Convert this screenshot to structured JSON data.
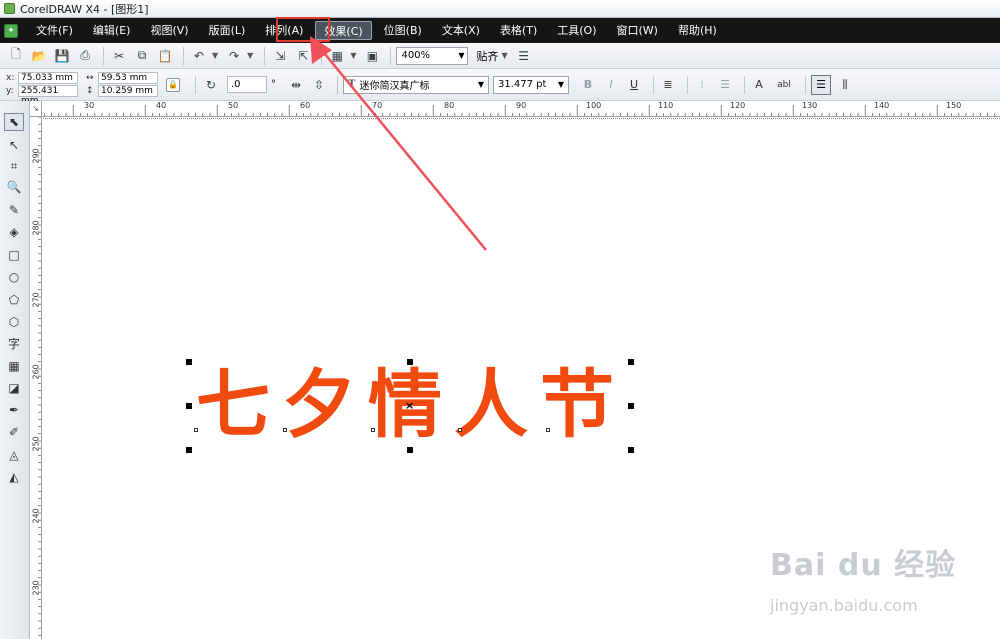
{
  "window": {
    "title": "CorelDRAW X4 - [图形1]"
  },
  "menu": {
    "items": [
      {
        "label": "文件(F)"
      },
      {
        "label": "编辑(E)"
      },
      {
        "label": "视图(V)"
      },
      {
        "label": "版面(L)"
      },
      {
        "label": "排列(A)"
      },
      {
        "label": "效果(C)",
        "active": true
      },
      {
        "label": "位图(B)"
      },
      {
        "label": "文本(X)"
      },
      {
        "label": "表格(T)"
      },
      {
        "label": "工具(O)"
      },
      {
        "label": "窗口(W)"
      },
      {
        "label": "帮助(H)"
      }
    ]
  },
  "standard_toolbar": {
    "icons": [
      "new-icon",
      "open-icon",
      "save-icon",
      "print-icon",
      "cut-icon",
      "copy-icon",
      "paste-icon",
      "undo-icon",
      "redo-icon",
      "import-icon",
      "export-icon",
      "application-launcher-icon",
      "welcome-screen-icon"
    ],
    "zoom_level": "400%",
    "snap_label": "贴齐"
  },
  "property_bar": {
    "x_label": "x:",
    "x_value": "75.033 mm",
    "y_label": "y:",
    "y_value": "255.431 mm",
    "width_value": "59.53 mm",
    "height_value": "10.259 mm",
    "rotation_value": ".0",
    "rotation_unit": "°",
    "font_name": "迷你简汉真广标",
    "font_size": "31.477 pt",
    "bold_label": "B",
    "italic_label": "I",
    "underline_label": "U",
    "text_abl_label": "abl"
  },
  "rulers": {
    "horizontal_labels": [
      "30",
      "40",
      "50",
      "60",
      "70",
      "80",
      "90",
      "100",
      "110",
      "120",
      "130",
      "140",
      "150"
    ],
    "vertical_labels": [
      "290",
      "280",
      "270",
      "260",
      "250",
      "240",
      "230"
    ],
    "corner_glyph": "↘"
  },
  "toolbox": {
    "tools": [
      "pick-tool-icon",
      "shape-tool-icon",
      "crop-tool-icon",
      "zoom-tool-icon",
      "freehand-tool-icon",
      "smart-fill-tool-icon",
      "rectangle-tool-icon",
      "ellipse-tool-icon",
      "polygon-tool-icon",
      "basic-shapes-tool-icon",
      "text-tool-icon",
      "table-tool-icon",
      "interactive-tool-icon",
      "eyedropper-tool-icon",
      "outline-tool-icon",
      "fill-tool-icon",
      "interactive-fill-icon"
    ],
    "text_tool_glyph": "字"
  },
  "canvas": {
    "artwork_text": "七夕情人节",
    "artwork_color": "#f04a0e"
  },
  "watermark": {
    "main": "Bai du 经验",
    "sub": "jingyan.baidu.com"
  },
  "colors": {
    "menu_bg": "#151515",
    "highlight": "#e23b2e"
  }
}
